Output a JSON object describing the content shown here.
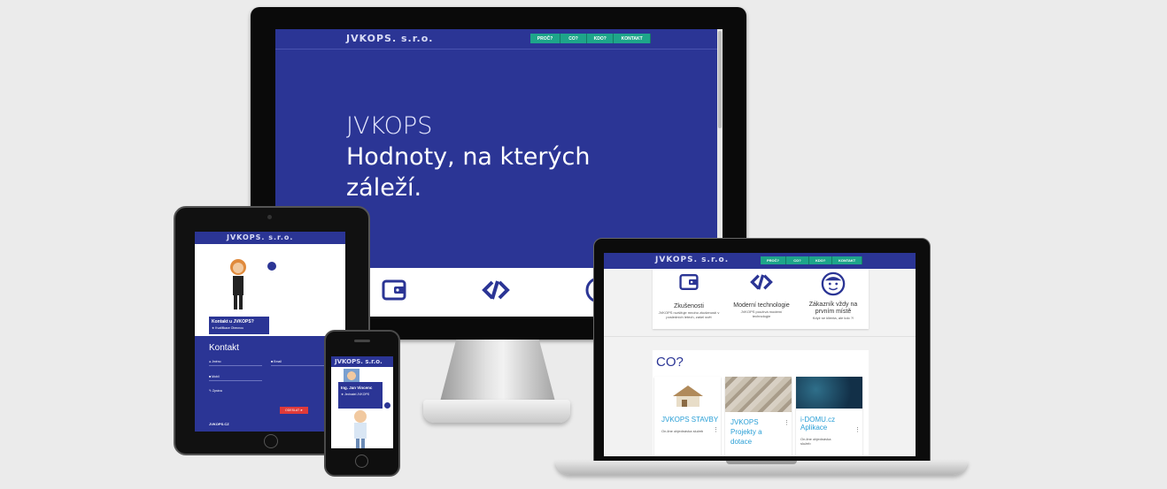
{
  "brand": "JVKOPS. s.r.o.",
  "nav": [
    "PROČ?",
    "CO?",
    "KDO?",
    "KONTAKT"
  ],
  "hero": {
    "line1": "JVKOPS",
    "line2": "Hodnoty, na kterých",
    "line3": "záleží."
  },
  "features": [
    {
      "title": "Zkušenosti",
      "text": "JVKOPS rozšiřuje mnoho zkušeností v posledních letech, zašel svět"
    },
    {
      "title": "Moderní technologie",
      "text": "JVKOPS používá moderní technologie"
    },
    {
      "title": "Zákazník vždy na prvním místě",
      "text": "Když se klienta, ale kdo ?!"
    }
  ],
  "co_section": {
    "heading": "CO?",
    "cards": [
      {
        "title": "JVKOPS STAVBY",
        "sub": "On-line objednávka služeb"
      },
      {
        "title": "JVKOPS Projekty a dotace",
        "sub": ""
      },
      {
        "title": "i-DOMU.cz Aplikace",
        "sub": "On-line objednávka služeb"
      }
    ],
    "more": "⋮"
  },
  "tablet": {
    "person_label": "Kontakt u JVKOPS?",
    "person_sub": "★ Kvalifikace Obecnou",
    "contact_heading": "Kontakt",
    "fields": [
      "Jméno",
      "Email",
      "Mobil",
      "Zpráva"
    ],
    "send": "ODESLAT ➤",
    "footer": "JVKOPS.CZ"
  },
  "phone": {
    "person_name": "Ing. Jan Vincenc",
    "person_role": "★ Jednatel JVKOPS"
  },
  "colors": {
    "primary": "#2b3595",
    "accent": "#1ea58a",
    "link": "#2a9fd6",
    "send": "#e03a3a"
  }
}
